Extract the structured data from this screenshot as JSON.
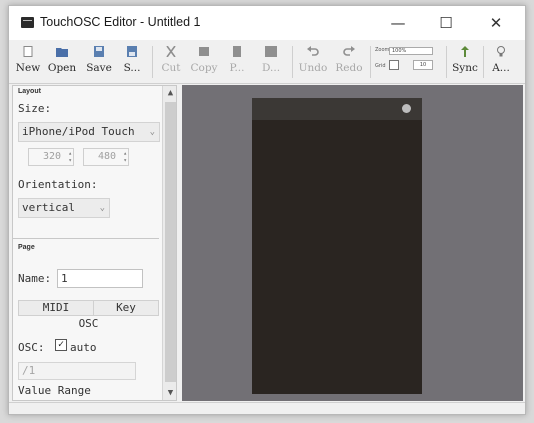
{
  "window": {
    "title": "TouchOSC Editor - Untitled 1",
    "controls": {
      "minimize": "—",
      "maximize": "☐",
      "close": "✕"
    }
  },
  "toolbar": {
    "new": "New",
    "open": "Open",
    "save": "Save",
    "save_as": "S...",
    "cut": "Cut",
    "copy": "Copy",
    "paste": "P...",
    "delete": "D...",
    "undo": "Undo",
    "redo": "Redo",
    "sync": "Sync",
    "about": "A...",
    "zoom_label": "Zoom",
    "zoom_value": "100%",
    "grid_label": "Grid",
    "grid_value": "10"
  },
  "layout": {
    "section_title": "Layout",
    "size_label": "Size:",
    "size_value": "iPhone/iPod Touch",
    "width": "320",
    "height": "480",
    "orientation_label": "Orientation:",
    "orientation_value": "vertical"
  },
  "page": {
    "section_title": "Page",
    "name_label": "Name:",
    "name_value": "1",
    "tabs": [
      "MIDI",
      "Key",
      "OSC"
    ],
    "osc_label": "OSC:",
    "osc_auto_checked": true,
    "osc_auto_label": "auto",
    "osc_address": "/1",
    "value_range_label": "Value Range"
  },
  "colors": {
    "canvas_bg": "#727075",
    "device_bg": "#2a2521",
    "device_tabbar": "#3b3835"
  }
}
